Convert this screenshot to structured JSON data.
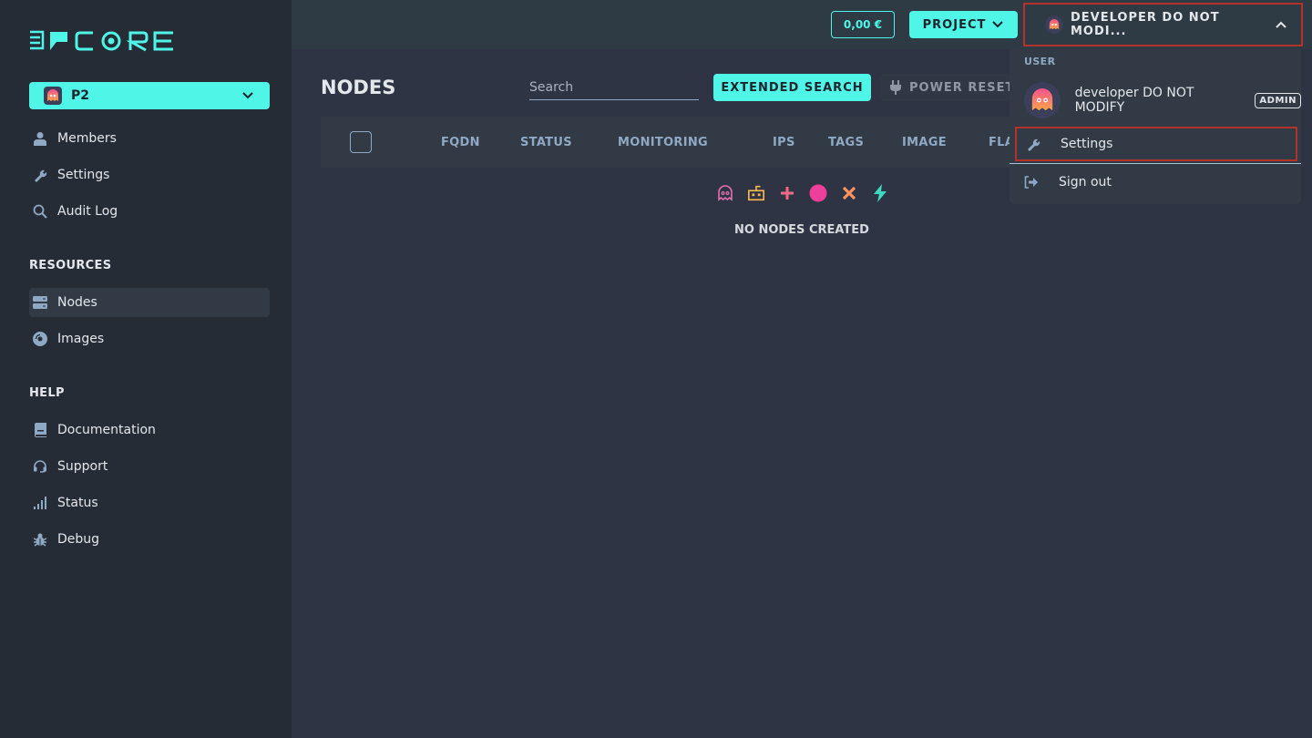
{
  "brand": {
    "name": "CORE",
    "accent": "#4ff5e6"
  },
  "sidebar": {
    "project": {
      "name": "P2"
    },
    "items": [
      {
        "label": "Members",
        "icon": "user-icon"
      },
      {
        "label": "Settings",
        "icon": "wrench-icon"
      },
      {
        "label": "Audit Log",
        "icon": "search-icon"
      }
    ],
    "resources_title": "RESOURCES",
    "resources": [
      {
        "label": "Nodes",
        "icon": "server-icon",
        "active": true
      },
      {
        "label": "Images",
        "icon": "disc-icon"
      }
    ],
    "help_title": "HELP",
    "help": [
      {
        "label": "Documentation",
        "icon": "book-icon"
      },
      {
        "label": "Support",
        "icon": "headset-icon"
      },
      {
        "label": "Status",
        "icon": "signal-icon"
      },
      {
        "label": "Debug",
        "icon": "bug-icon"
      }
    ]
  },
  "header": {
    "balance": "0,00 €",
    "project_button": "PROJECT",
    "user_button": "DEVELOPER DO NOT MODI..."
  },
  "main": {
    "title": "NODES",
    "search_placeholder": "Search",
    "extended_search": "EXTENDED SEARCH",
    "power_reset": "POWER RESET",
    "columns": [
      "FQDN",
      "STATUS",
      "MONITORING",
      "IPS",
      "TAGS",
      "IMAGE",
      "FLA"
    ],
    "empty_icons": [
      "ghost-icon",
      "robot-icon",
      "plus-icon",
      "circle-icon",
      "x-icon",
      "bolt-icon"
    ],
    "empty_text": "NO NODES CREATED"
  },
  "dropdown": {
    "section": "USER",
    "user_name": "developer DO NOT MODIFY",
    "badge": "ADMIN",
    "items": [
      {
        "label": "Settings",
        "icon": "wrench-icon"
      },
      {
        "label": "Sign out",
        "icon": "sign-out-icon"
      }
    ]
  }
}
